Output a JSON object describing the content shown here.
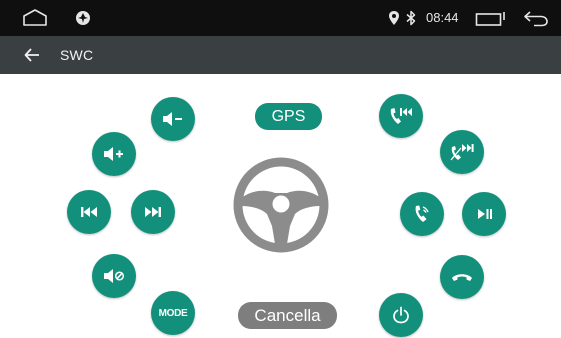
{
  "statusbar": {
    "time": "08:44",
    "icons": [
      "home-outline-icon",
      "settings-aperture-icon",
      "location-pin-icon",
      "bluetooth-icon",
      "recent-apps-icon",
      "back-arrow-icon"
    ]
  },
  "titlebar": {
    "back_icon": "arrow-left-icon",
    "title": "SWC"
  },
  "swc": {
    "gps_label": "GPS",
    "cancel_label": "Cancella",
    "mode_label": "MODE",
    "accent_color": "#12907b",
    "cancel_color": "#7e7e7e",
    "buttons_left": [
      "volume-down-icon",
      "volume-up-icon",
      "previous-track-icon",
      "next-track-icon",
      "mute-icon",
      "mode-button"
    ],
    "buttons_right": [
      "call-previous-icon",
      "call-next-icon",
      "phone-answer-icon",
      "play-pause-icon",
      "hang-up-icon",
      "power-icon"
    ],
    "center_icon": "steering-wheel-icon"
  }
}
